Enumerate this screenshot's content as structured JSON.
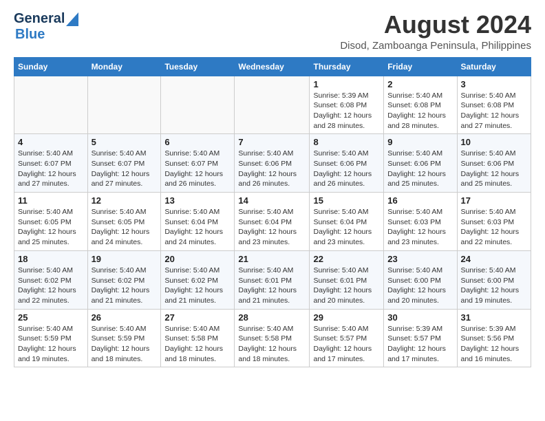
{
  "header": {
    "logo_general": "General",
    "logo_blue": "Blue",
    "month_title": "August 2024",
    "location": "Disod, Zamboanga Peninsula, Philippines"
  },
  "weekdays": [
    "Sunday",
    "Monday",
    "Tuesday",
    "Wednesday",
    "Thursday",
    "Friday",
    "Saturday"
  ],
  "weeks": [
    [
      {
        "day": "",
        "detail": ""
      },
      {
        "day": "",
        "detail": ""
      },
      {
        "day": "",
        "detail": ""
      },
      {
        "day": "",
        "detail": ""
      },
      {
        "day": "1",
        "detail": "Sunrise: 5:39 AM\nSunset: 6:08 PM\nDaylight: 12 hours\nand 28 minutes."
      },
      {
        "day": "2",
        "detail": "Sunrise: 5:40 AM\nSunset: 6:08 PM\nDaylight: 12 hours\nand 28 minutes."
      },
      {
        "day": "3",
        "detail": "Sunrise: 5:40 AM\nSunset: 6:08 PM\nDaylight: 12 hours\nand 27 minutes."
      }
    ],
    [
      {
        "day": "4",
        "detail": "Sunrise: 5:40 AM\nSunset: 6:07 PM\nDaylight: 12 hours\nand 27 minutes."
      },
      {
        "day": "5",
        "detail": "Sunrise: 5:40 AM\nSunset: 6:07 PM\nDaylight: 12 hours\nand 27 minutes."
      },
      {
        "day": "6",
        "detail": "Sunrise: 5:40 AM\nSunset: 6:07 PM\nDaylight: 12 hours\nand 26 minutes."
      },
      {
        "day": "7",
        "detail": "Sunrise: 5:40 AM\nSunset: 6:06 PM\nDaylight: 12 hours\nand 26 minutes."
      },
      {
        "day": "8",
        "detail": "Sunrise: 5:40 AM\nSunset: 6:06 PM\nDaylight: 12 hours\nand 26 minutes."
      },
      {
        "day": "9",
        "detail": "Sunrise: 5:40 AM\nSunset: 6:06 PM\nDaylight: 12 hours\nand 25 minutes."
      },
      {
        "day": "10",
        "detail": "Sunrise: 5:40 AM\nSunset: 6:06 PM\nDaylight: 12 hours\nand 25 minutes."
      }
    ],
    [
      {
        "day": "11",
        "detail": "Sunrise: 5:40 AM\nSunset: 6:05 PM\nDaylight: 12 hours\nand 25 minutes."
      },
      {
        "day": "12",
        "detail": "Sunrise: 5:40 AM\nSunset: 6:05 PM\nDaylight: 12 hours\nand 24 minutes."
      },
      {
        "day": "13",
        "detail": "Sunrise: 5:40 AM\nSunset: 6:04 PM\nDaylight: 12 hours\nand 24 minutes."
      },
      {
        "day": "14",
        "detail": "Sunrise: 5:40 AM\nSunset: 6:04 PM\nDaylight: 12 hours\nand 23 minutes."
      },
      {
        "day": "15",
        "detail": "Sunrise: 5:40 AM\nSunset: 6:04 PM\nDaylight: 12 hours\nand 23 minutes."
      },
      {
        "day": "16",
        "detail": "Sunrise: 5:40 AM\nSunset: 6:03 PM\nDaylight: 12 hours\nand 23 minutes."
      },
      {
        "day": "17",
        "detail": "Sunrise: 5:40 AM\nSunset: 6:03 PM\nDaylight: 12 hours\nand 22 minutes."
      }
    ],
    [
      {
        "day": "18",
        "detail": "Sunrise: 5:40 AM\nSunset: 6:02 PM\nDaylight: 12 hours\nand 22 minutes."
      },
      {
        "day": "19",
        "detail": "Sunrise: 5:40 AM\nSunset: 6:02 PM\nDaylight: 12 hours\nand 21 minutes."
      },
      {
        "day": "20",
        "detail": "Sunrise: 5:40 AM\nSunset: 6:02 PM\nDaylight: 12 hours\nand 21 minutes."
      },
      {
        "day": "21",
        "detail": "Sunrise: 5:40 AM\nSunset: 6:01 PM\nDaylight: 12 hours\nand 21 minutes."
      },
      {
        "day": "22",
        "detail": "Sunrise: 5:40 AM\nSunset: 6:01 PM\nDaylight: 12 hours\nand 20 minutes."
      },
      {
        "day": "23",
        "detail": "Sunrise: 5:40 AM\nSunset: 6:00 PM\nDaylight: 12 hours\nand 20 minutes."
      },
      {
        "day": "24",
        "detail": "Sunrise: 5:40 AM\nSunset: 6:00 PM\nDaylight: 12 hours\nand 19 minutes."
      }
    ],
    [
      {
        "day": "25",
        "detail": "Sunrise: 5:40 AM\nSunset: 5:59 PM\nDaylight: 12 hours\nand 19 minutes."
      },
      {
        "day": "26",
        "detail": "Sunrise: 5:40 AM\nSunset: 5:59 PM\nDaylight: 12 hours\nand 18 minutes."
      },
      {
        "day": "27",
        "detail": "Sunrise: 5:40 AM\nSunset: 5:58 PM\nDaylight: 12 hours\nand 18 minutes."
      },
      {
        "day": "28",
        "detail": "Sunrise: 5:40 AM\nSunset: 5:58 PM\nDaylight: 12 hours\nand 18 minutes."
      },
      {
        "day": "29",
        "detail": "Sunrise: 5:40 AM\nSunset: 5:57 PM\nDaylight: 12 hours\nand 17 minutes."
      },
      {
        "day": "30",
        "detail": "Sunrise: 5:39 AM\nSunset: 5:57 PM\nDaylight: 12 hours\nand 17 minutes."
      },
      {
        "day": "31",
        "detail": "Sunrise: 5:39 AM\nSunset: 5:56 PM\nDaylight: 12 hours\nand 16 minutes."
      }
    ]
  ]
}
